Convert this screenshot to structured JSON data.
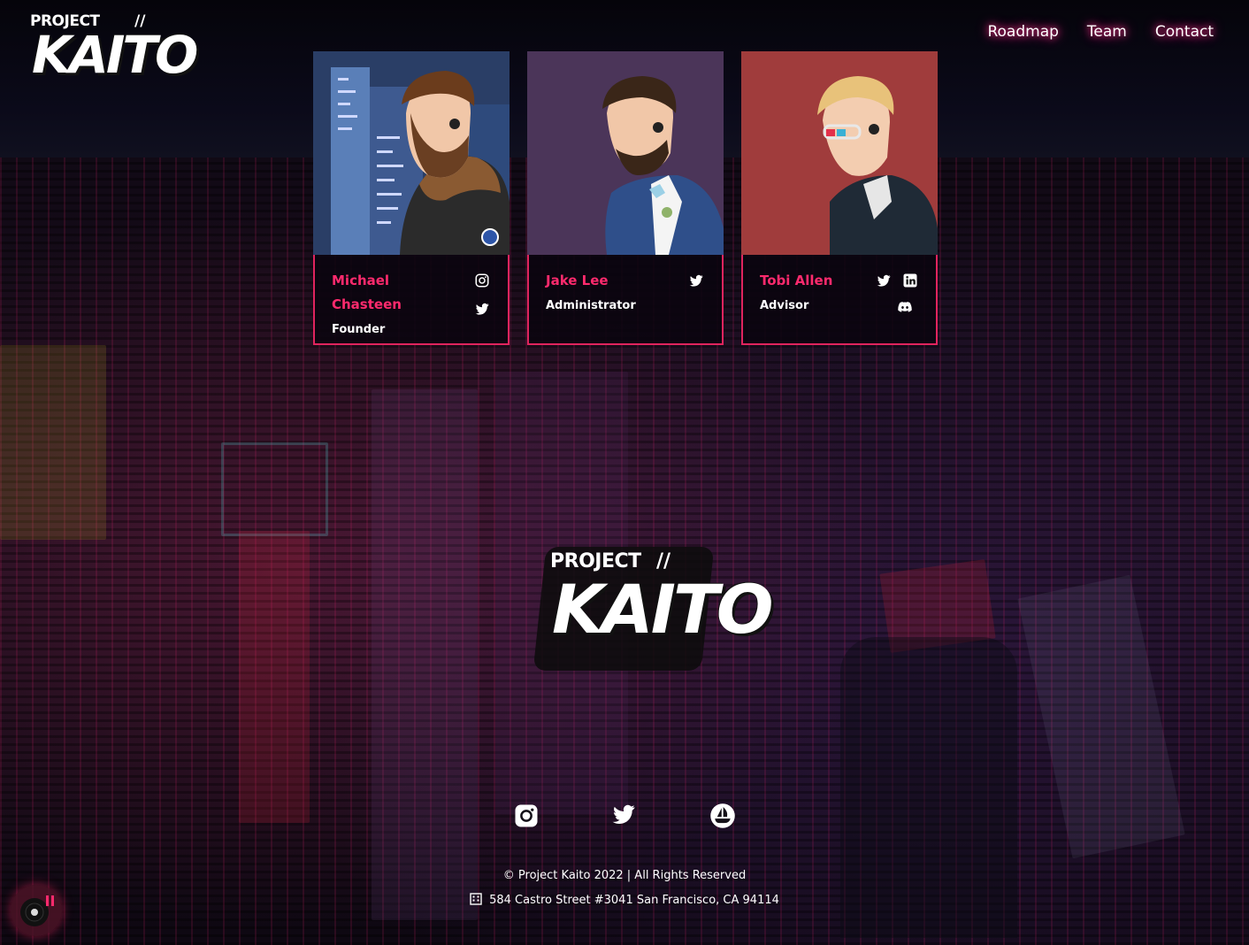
{
  "brand": {
    "logo_line1": "PROJECT",
    "logo_line2": "KAITO",
    "logo_mark": "//"
  },
  "nav": {
    "items": [
      {
        "label": "Roadmap"
      },
      {
        "label": "Team"
      },
      {
        "label": "Contact"
      }
    ]
  },
  "team": [
    {
      "name": "Michael Chasteen",
      "role": "Founder",
      "portrait_bg": "#3a5a8a",
      "socials": [
        "instagram-icon",
        "twitter-icon"
      ]
    },
    {
      "name": "Jake Lee",
      "role": "Administrator",
      "portrait_bg": "#4a3458",
      "socials": [
        "twitter-icon"
      ]
    },
    {
      "name": "Tobi Allen",
      "role": "Advisor",
      "portrait_bg": "#a33d3d",
      "socials": [
        "twitter-icon",
        "linkedin-icon",
        "discord-icon"
      ]
    }
  ],
  "footer": {
    "socials": [
      "instagram-icon",
      "twitter-icon",
      "opensea-icon"
    ],
    "copyright": "© Project Kaito 2022 | All Rights Reserved",
    "address": "584 Castro Street #3041 San Francisco, CA 94114"
  },
  "colors": {
    "accent": "#ff2a6d",
    "card_border": "#e0245e",
    "nav_glow": "#ff2f8a"
  }
}
